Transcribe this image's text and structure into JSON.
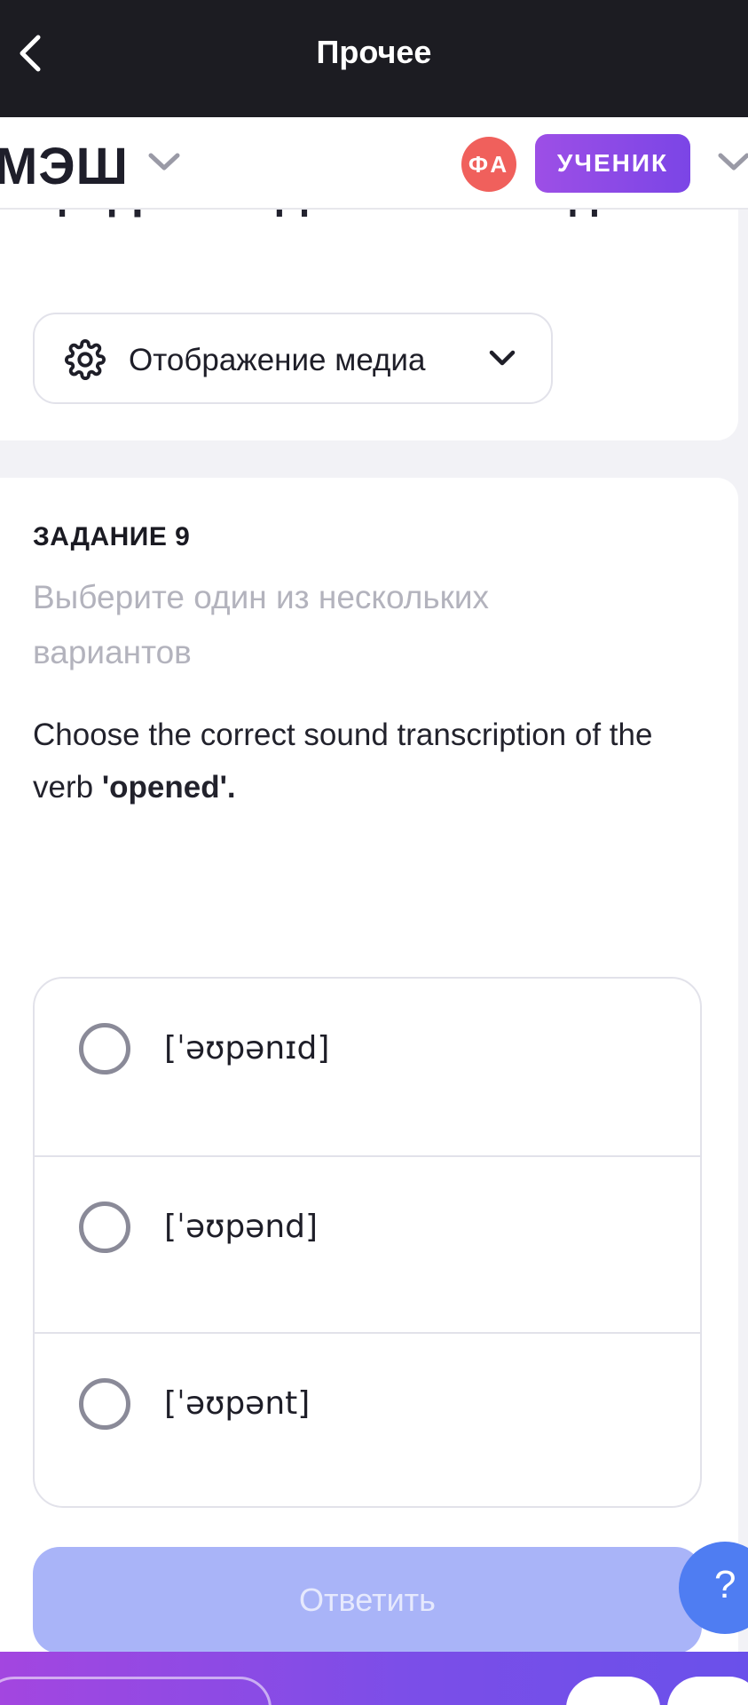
{
  "topbar": {
    "title": "Прочее",
    "back_icon": "chevron-left-icon"
  },
  "header": {
    "logo": "МЭШ",
    "avatar_initials": "ФА",
    "role": "УЧЕНИК",
    "colors": {
      "avatar": "#f0605c",
      "role": "#8a48e6"
    }
  },
  "homework": {
    "title": "Цифровое Домашнее Задание",
    "media_select": {
      "label": "Отображение медиа",
      "icon": "gear-icon"
    }
  },
  "task": {
    "number": "ЗАДАНИЕ 9",
    "hint": "Выберите один из нескольких вариантов",
    "question_prefix": "Choose the correct sound transcription of the verb ",
    "question_bold": "'opened'.",
    "options": [
      {
        "text": "[ˈəʊpənɪd]",
        "selected": false
      },
      {
        "text": "[ˈəʊpənd]",
        "selected": false
      },
      {
        "text": "[ˈəʊpənt]",
        "selected": false
      }
    ]
  },
  "actions": {
    "submit_label": "Ответить",
    "help_label": "?"
  },
  "colors": {
    "topbar": "#1c1c22",
    "submit_disabled": "#a9b4f8",
    "help": "#4f7df2",
    "bottom_gradient_start": "#a346e0",
    "bottom_gradient_end": "#6a50ea"
  }
}
